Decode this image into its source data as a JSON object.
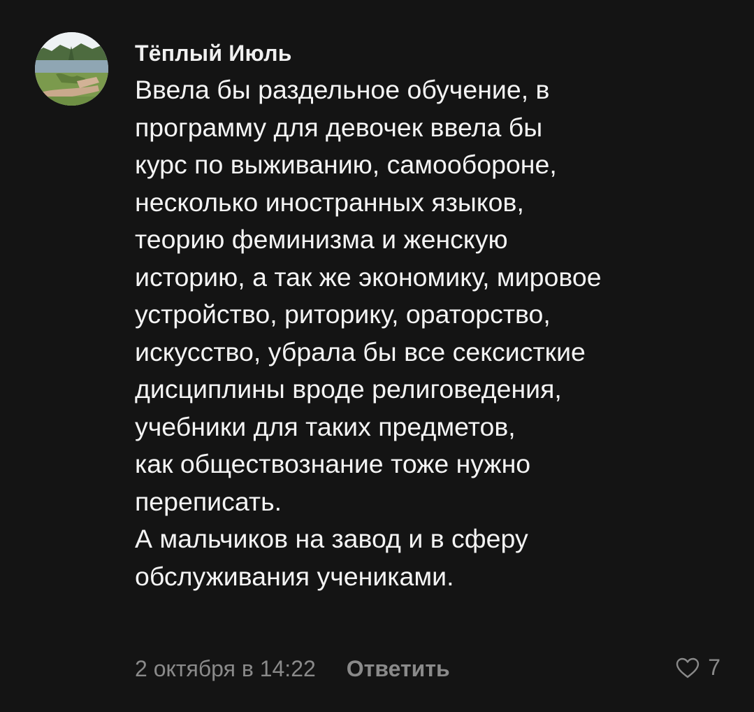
{
  "comment": {
    "author": "Тёплый Июль",
    "avatar_icon": "avatar-photo-lake",
    "lines": [
      "Ввела бы раздельное обучение, в",
      "программу для девочек ввела бы",
      "курс по выживанию, самообороне,",
      "несколько иностранных языков,",
      "теорию феминизма и женскую",
      "историю, а так же экономику, мировое",
      "устройство, риторику, ораторство,",
      "искусство, убрала бы все сексисткие",
      "дисциплины вроде религоведения,",
      "учебники для таких предметов,",
      "как обществознание тоже нужно",
      "переписать.",
      "А мальчиков на завод и в сферу",
      "обслуживания учениками."
    ],
    "date": "2 октября в 14:22",
    "reply_label": "Ответить",
    "like_icon": "heart-outline-icon",
    "like_count": "7"
  },
  "colors": {
    "background": "#141414",
    "text": "#f4f4f4",
    "muted": "#8a8a8a"
  }
}
